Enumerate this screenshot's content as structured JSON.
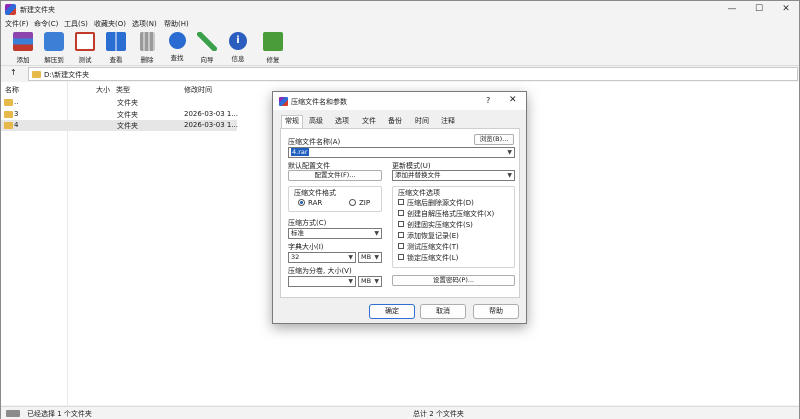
{
  "window": {
    "title": "新建文件夹",
    "controls": {
      "minimize": "—",
      "maximize": "☐",
      "close": "✕"
    }
  },
  "menu": [
    "文件(F)",
    "命令(C)",
    "工具(S)",
    "收藏夹(O)",
    "选项(N)",
    "帮助(H)"
  ],
  "toolbar": [
    {
      "label": "添加",
      "icon": "archive-add-icon",
      "color": "#7a3fbf"
    },
    {
      "label": "解压到",
      "icon": "extract-folder-icon",
      "color": "#3b7fd6"
    },
    {
      "label": "测试",
      "icon": "test-clipboard-icon",
      "color": "#c0392b"
    },
    {
      "label": "查看",
      "icon": "view-book-icon",
      "color": "#2b6ed2"
    },
    {
      "label": "删除",
      "icon": "trash-can-icon",
      "color": "#8a8a8a"
    },
    {
      "label": "查找",
      "icon": "magnifier-icon",
      "color": "#2a6bd1"
    },
    {
      "label": "向导",
      "icon": "wizard-wand-icon",
      "color": "#3aa04a"
    },
    {
      "label": "信息",
      "icon": "info-circle-icon",
      "color": "#2a5dbd"
    },
    {
      "label": "修复",
      "icon": "repair-kit-icon",
      "color": "#4a9b3a"
    }
  ],
  "path": {
    "text": "D:\\新建文件夹"
  },
  "columns": {
    "name": "名称",
    "size": "大小",
    "type": "类型",
    "modified": "修改时间"
  },
  "files": [
    {
      "name": "..",
      "type": "文件夹",
      "modified": ""
    },
    {
      "name": "3",
      "type": "文件夹",
      "modified": "2026-03-03 1..."
    },
    {
      "name": "4",
      "type": "文件夹",
      "modified": "2026-03-03 1..."
    }
  ],
  "status": {
    "left": "已经选择 1 个文件夹",
    "right": "总计 2 个文件夹"
  },
  "dialog": {
    "title": "压缩文件名和参数",
    "help": "?",
    "close": "✕",
    "tabs": [
      "常规",
      "高级",
      "选项",
      "文件",
      "备份",
      "时间",
      "注释"
    ],
    "archive_name_label": "压缩文件名称(A)",
    "browse_button": "浏览(B)...",
    "archive_name_value": "4.rar",
    "default_profile_label": "默认配置文件",
    "profiles_button": "配置文件(F)...",
    "update_mode_label": "更新模式(U)",
    "update_mode_value": "添加并替换文件",
    "format_group": "压缩文件格式",
    "format_rar": "RAR",
    "format_zip": "ZIP",
    "method_label": "压缩方式(C)",
    "method_value": "标准",
    "dict_label": "字典大小(I)",
    "dict_value": "32",
    "dict_unit": "MB",
    "split_label": "压缩为分卷, 大小(V)",
    "split_value": "",
    "split_unit": "MB",
    "options_group": "压缩文件选项",
    "options": [
      "压缩后删除源文件(D)",
      "创建自解压格式压缩文件(X)",
      "创建固实压缩文件(S)",
      "添加恢复记录(E)",
      "测试压缩文件(T)",
      "锁定压缩文件(L)"
    ],
    "password_button": "设置密码(P)...",
    "ok": "确定",
    "cancel": "取消",
    "help_button": "帮助"
  }
}
